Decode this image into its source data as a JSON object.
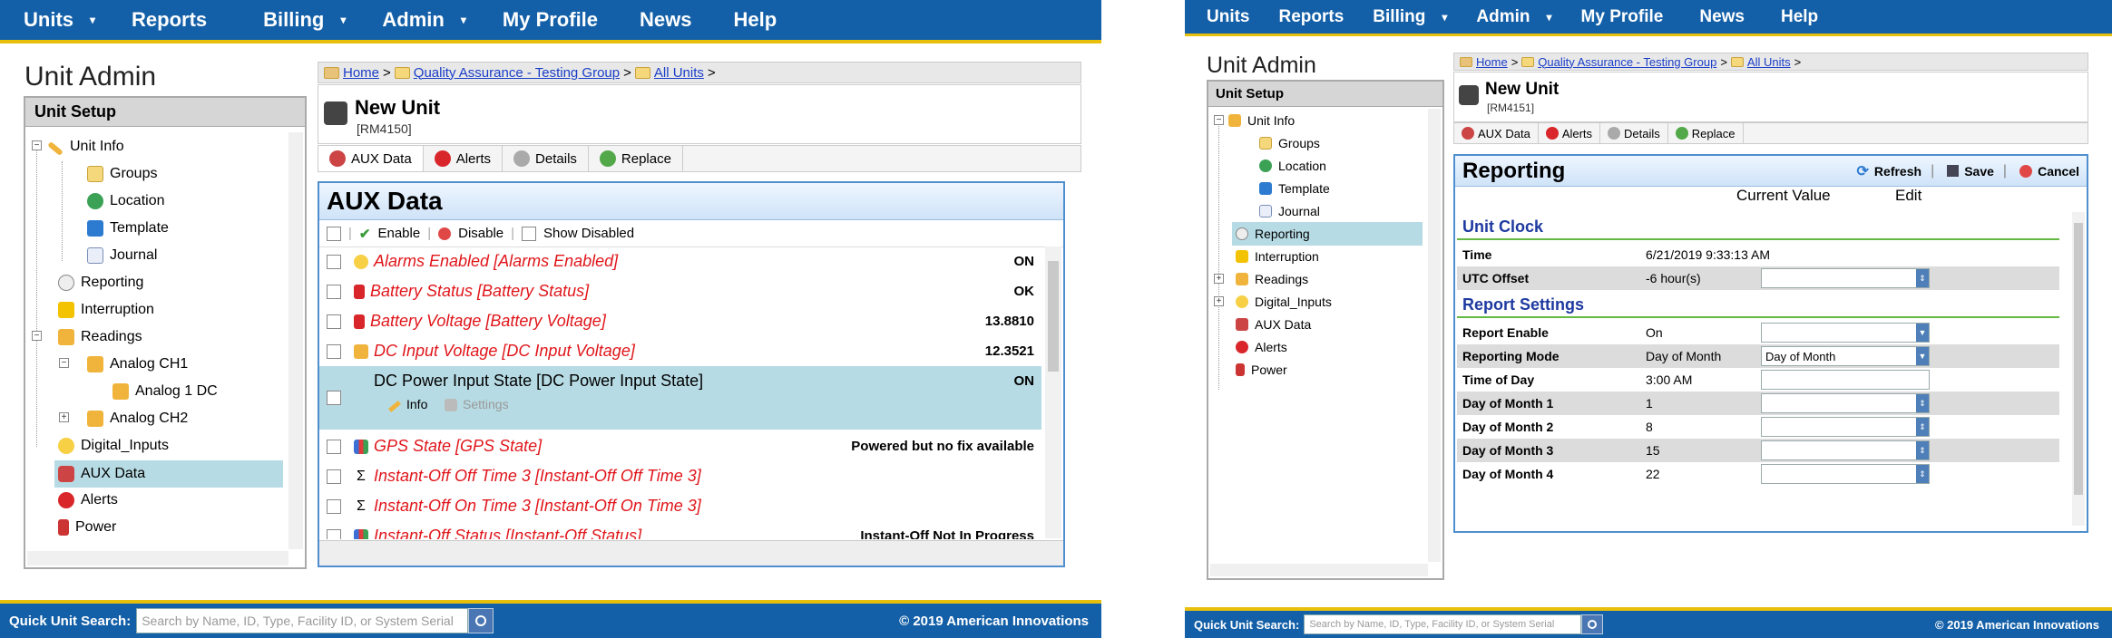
{
  "nav": {
    "items": [
      {
        "label": "Units",
        "caret": true
      },
      {
        "label": "Reports",
        "caret": false
      },
      {
        "label": "Billing",
        "caret": true
      },
      {
        "label": "Admin",
        "caret": true
      },
      {
        "label": "My Profile",
        "caret": false
      },
      {
        "label": "News",
        "caret": false
      },
      {
        "label": "Help",
        "caret": false
      }
    ],
    "caret_glyph": "▾"
  },
  "sidebar": {
    "page_title": "Unit Admin",
    "header": "Unit Setup",
    "items": {
      "unit_info": "Unit Info",
      "groups": "Groups",
      "location": "Location",
      "template": "Template",
      "journal": "Journal",
      "reporting": "Reporting",
      "interruption": "Interruption",
      "readings": "Readings",
      "analog_ch1": "Analog CH1",
      "analog_1_dc": "Analog 1 DC",
      "analog_ch2": "Analog CH2",
      "digital_inputs": "Digital_Inputs",
      "aux_data": "AUX Data",
      "alerts": "Alerts",
      "power": "Power"
    }
  },
  "breadcrumb": {
    "home": "Home",
    "group": "Quality Assurance - Testing Group",
    "all_units": "All Units",
    "sep": ">"
  },
  "unit": {
    "name": "New Unit",
    "id_a": "[RM4150]",
    "id_b": "[RM4151]"
  },
  "tabs": {
    "aux": "AUX Data",
    "alerts": "Alerts",
    "details": "Details",
    "replace": "Replace"
  },
  "aux": {
    "title": "AUX Data",
    "enable": "Enable",
    "disable": "Disable",
    "show_disabled": "Show Disabled",
    "info": "Info",
    "settings": "Settings",
    "rows": [
      {
        "name": "Alarms Enabled [Alarms Enabled]",
        "value": "ON"
      },
      {
        "name": "Battery Status [Battery Status]",
        "value": "OK"
      },
      {
        "name": "Battery Voltage [Battery Voltage]",
        "value": "13.8810"
      },
      {
        "name": "DC Input Voltage [DC Input Voltage]",
        "value": "12.3521"
      },
      {
        "name": "DC Power Input State [DC Power Input State]",
        "value": "ON"
      },
      {
        "name": "GPS State [GPS State]",
        "value": "Powered but no fix available"
      },
      {
        "name": "Instant-Off Off Time 3 [Instant-Off Off Time 3]",
        "value": ""
      },
      {
        "name": "Instant-Off On Time 3 [Instant-Off On Time 3]",
        "value": ""
      },
      {
        "name": "Instant-Off Status [Instant-Off Status]",
        "value": "Instant-Off Not In Progress"
      }
    ]
  },
  "reporting": {
    "title": "Reporting",
    "refresh": "Refresh",
    "save": "Save",
    "cancel": "Cancel",
    "col_current": "Current Value",
    "col_edit": "Edit",
    "sec_clock": "Unit Clock",
    "sec_report": "Report Settings",
    "rows": [
      {
        "label": "Time",
        "value": "6/21/2019 9:33:13 AM",
        "edit": ""
      },
      {
        "label": "UTC Offset",
        "value": "-6 hour(s)",
        "edit": ""
      },
      {
        "label": "Report Enable",
        "value": "On",
        "edit": ""
      },
      {
        "label": "Reporting Mode",
        "value": "Day of Month",
        "edit": "Day of Month"
      },
      {
        "label": "Time of Day",
        "value": "3:00 AM",
        "edit": ""
      },
      {
        "label": "Day of Month 1",
        "value": "1",
        "edit": ""
      },
      {
        "label": "Day of Month 2",
        "value": "8",
        "edit": ""
      },
      {
        "label": "Day of Month 3",
        "value": "15",
        "edit": ""
      },
      {
        "label": "Day of Month 4",
        "value": "22",
        "edit": ""
      }
    ]
  },
  "footer": {
    "search_label": "Quick Unit Search:",
    "search_placeholder": "Search by Name, ID, Type, Facility ID, or System Serial",
    "copyright": "© 2019 American Innovations"
  }
}
